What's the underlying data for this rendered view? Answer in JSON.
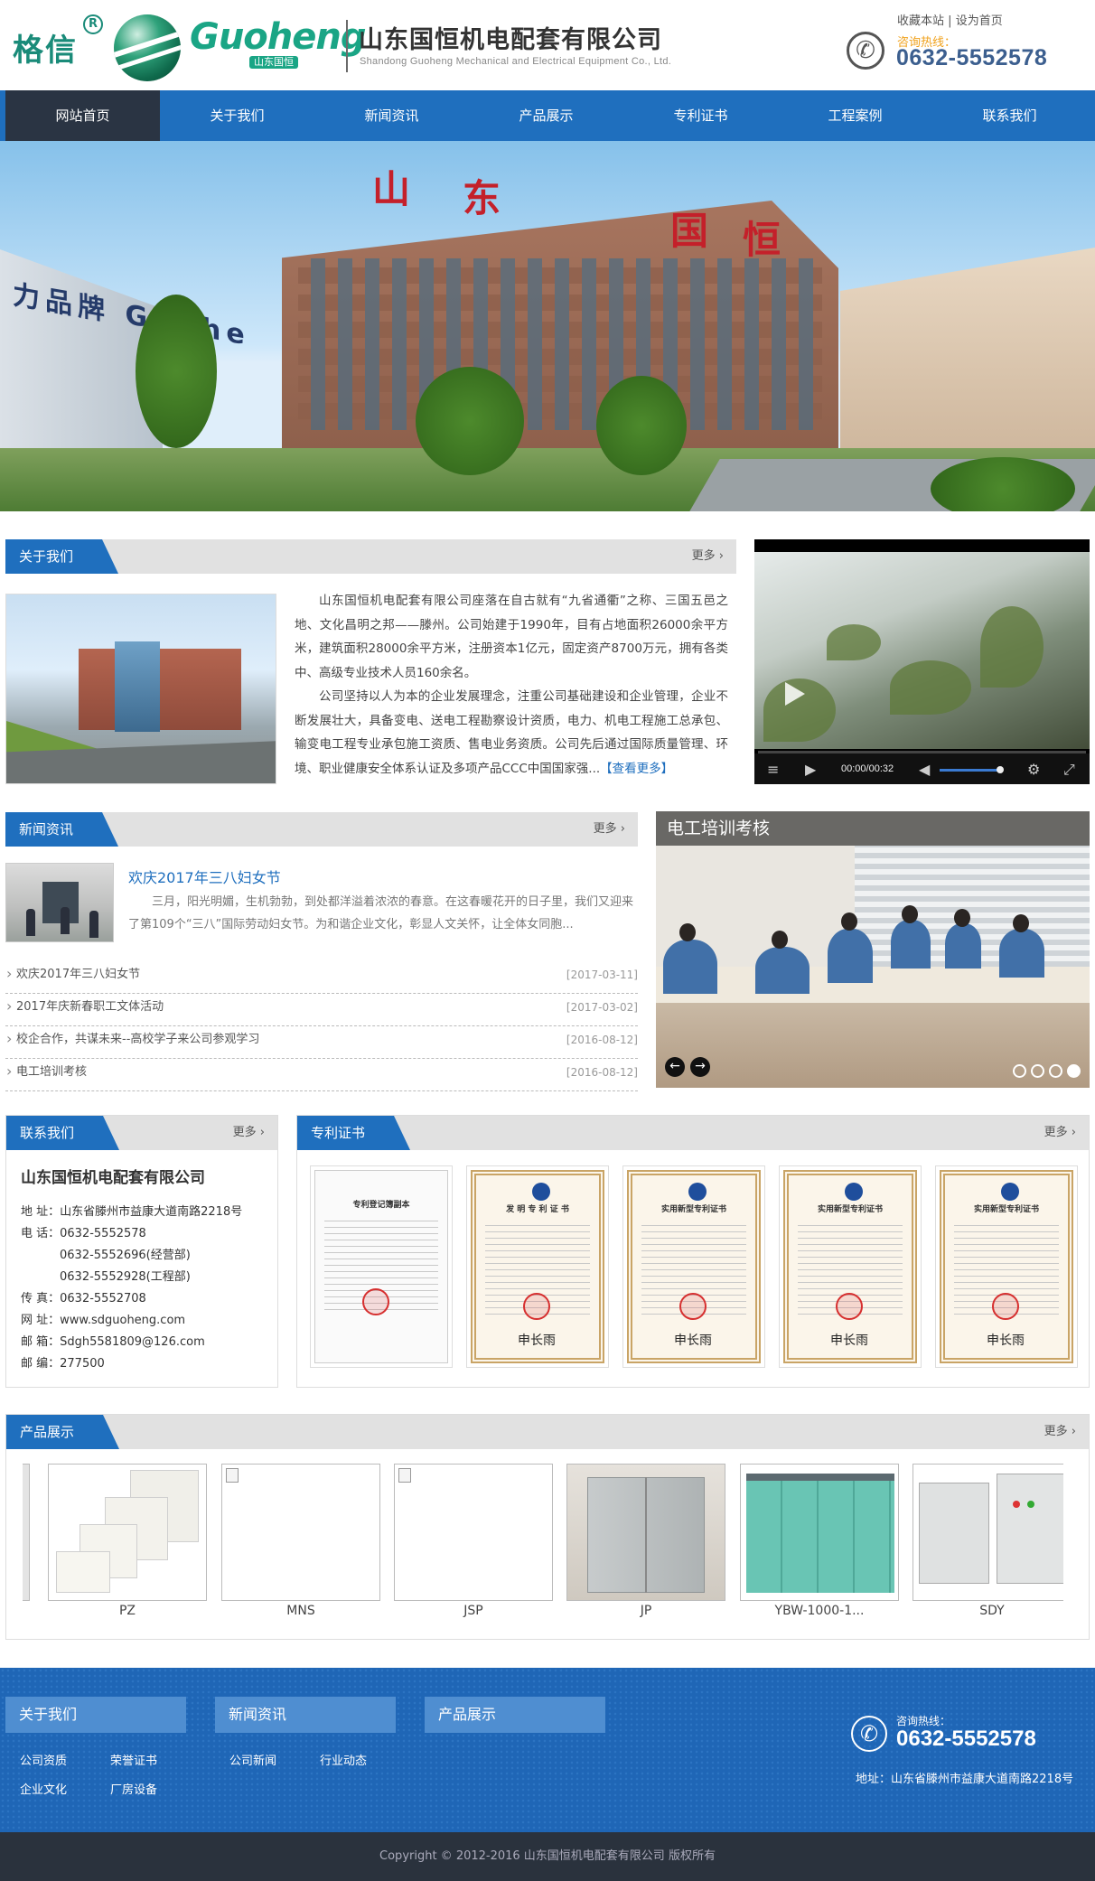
{
  "header": {
    "logo_cn": "格信",
    "logo_reg": "R",
    "logo_en": "Guoheng",
    "logo_cn_small": "山东国恒",
    "company_name": "山东国恒机电配套有限公司",
    "company_en": "Shandong Guoheng Mechanical and Electrical Equipment Co., Ltd.",
    "bookmark": "收藏本站",
    "sep": "|",
    "set_home": "设为首页",
    "hotline_label": "咨询热线：",
    "hotline": "0632-5552578"
  },
  "nav": [
    {
      "label": "网站首页"
    },
    {
      "label": "关于我们"
    },
    {
      "label": "新闻资讯"
    },
    {
      "label": "产品展示"
    },
    {
      "label": "专利证书"
    },
    {
      "label": "工程案例"
    },
    {
      "label": "联系我们"
    }
  ],
  "banner": {
    "sign_left": "力品牌 Guohe",
    "chars": [
      "山",
      "东",
      "国",
      "恒"
    ],
    "slide_count": 3,
    "active_slide": 3
  },
  "about": {
    "title": "关于我们",
    "more": "更多",
    "p1": "山东国恒机电配套有限公司座落在自古就有“九省通衢”之称、三国五邑之地、文化昌明之邦——滕州。公司始建于1990年，目有占地面积26000余平方米，建筑面积28000余平方米，注册资本1亿元，固定资产8700万元，拥有各类中、高级专业技术人员160余名。",
    "p2": "公司坚持以人为本的企业发展理念，注重公司基础建设和企业管理，企业不断发展壮大，具备变电、送电工程勘察设计资质，电力、机电工程施工总承包、输变电工程专业承包施工资质、售电业务资质。公司先后通过国际质量管理、环境、职业健康安全体系认证及多项产品CCC中国国家强...",
    "read_more": "【查看更多】"
  },
  "video": {
    "time": "00:00/00:32",
    "volume_percent": 85
  },
  "news": {
    "title": "新闻资讯",
    "more": "更多",
    "featured_title": "欢庆2017年三八妇女节",
    "featured_summary": "三月，阳光明媚，生机勃勃，到处都洋溢着浓浓的春意。在这春暖花开的日子里，我们又迎来了第109个“三八”国际劳动妇女节。为和谐企业文化，彰显人文关怀，让全体女同胞...",
    "items": [
      {
        "title": "欢庆2017年三八妇女节",
        "date": "[2017-03-11]"
      },
      {
        "title": "2017年庆新春职工文体活动",
        "date": "[2017-03-02]"
      },
      {
        "title": "校企合作，共谋未来--高校学子来公司参观学习",
        "date": "[2016-08-12]"
      },
      {
        "title": "电工培训考核",
        "date": "[2016-08-12]"
      }
    ]
  },
  "training": {
    "title": "电工培训考核",
    "prev": "←",
    "next": "→",
    "slide_count": 4,
    "active_slide": 4
  },
  "contact": {
    "title": "联系我们",
    "more": "更多",
    "company": "山东国恒机电配套有限公司",
    "address": "地 址：山东省滕州市益康大道南路2218号",
    "phone1": "电 话：0632-5552578",
    "phone2": "0632-5552696(经营部)",
    "phone3": "0632-5552928(工程部)",
    "fax": "传 真：0632-5552708",
    "web": "网 址：www.sdguoheng.com",
    "email": "邮 箱：Sdgh5581809@126.com",
    "zip": "邮 编：277500"
  },
  "patents": {
    "title": "专利证书",
    "more": "更多",
    "certs": [
      {
        "label": "专利登记簿副本"
      },
      {
        "label": "发 明 专 利 证 书"
      },
      {
        "label": "实用新型专利证书"
      },
      {
        "label": "实用新型专利证书"
      },
      {
        "label": "实用新型专利证书"
      }
    ]
  },
  "products": {
    "title": "产品展示",
    "more": "更多",
    "items": [
      {
        "name": "PZ"
      },
      {
        "name": "MNS"
      },
      {
        "name": "JSP"
      },
      {
        "name": "JP"
      },
      {
        "name": "YBW-1000-1..."
      },
      {
        "name": "SDY"
      }
    ]
  },
  "footer": {
    "col1_title": "关于我们",
    "col1_links": [
      "公司资质",
      "荣誉证书",
      "企业文化",
      "厂房设备"
    ],
    "col2_title": "新闻资讯",
    "col2_links": [
      "公司新闻",
      "行业动态"
    ],
    "col3_title": "产品展示",
    "hotline_label": "咨询热线：",
    "hotline": "0632-5552578",
    "address": "地址：山东省滕州市益康大道南路2218号",
    "copyright": "Copyright © 2012-2016 山东国恒机电配套有限公司 版权所有"
  },
  "colors": {
    "brand_blue": "#1f6fbe",
    "nav_active": "#2a3443",
    "logo_green": "#1a8b79",
    "hotline_orange": "#f0a11b"
  }
}
